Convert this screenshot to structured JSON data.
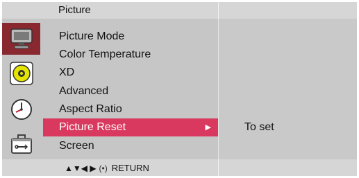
{
  "header": {
    "title": "Picture"
  },
  "categories": [
    {
      "icon": "monitor-icon",
      "active": true
    },
    {
      "icon": "audio-disc-icon",
      "active": false
    },
    {
      "icon": "clock-icon",
      "active": false
    },
    {
      "icon": "toolbox-icon",
      "active": false
    }
  ],
  "menu": {
    "items": [
      {
        "label": "Picture Mode"
      },
      {
        "label": "Color Temperature"
      },
      {
        "label": "XD"
      },
      {
        "label": "Advanced"
      },
      {
        "label": "Aspect Ratio"
      },
      {
        "label": "Picture Reset",
        "selected": true,
        "submenu_arrow": "▶"
      },
      {
        "label": "Screen"
      }
    ]
  },
  "detail": {
    "value": "To set"
  },
  "footer": {
    "nav_arrows": "▲▼◀ ▶",
    "enter_symbol": "(•)",
    "return_label": "RETURN"
  },
  "colors": {
    "selected_item": "#d9395e",
    "active_category": "#8a2830",
    "panel_bg": "#c6c6c6",
    "bar_bg": "#d6d6d6"
  }
}
